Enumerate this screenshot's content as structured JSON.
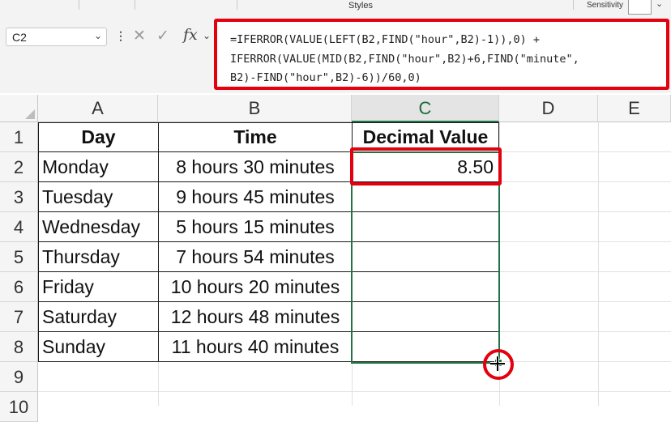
{
  "ribbon": {
    "styles_label": "Styles",
    "sensitivity_label": "Sensitivity"
  },
  "formula_bar": {
    "name_box": "C2",
    "fx_label": "fx",
    "formula_lines": [
      "=IFERROR(VALUE(LEFT(B2,FIND(\"hour\",B2)-1)),0) +",
      "IFERROR(VALUE(MID(B2,FIND(\"hour\",B2)+6,FIND(\"minute\",",
      "B2)-FIND(\"hour\",B2)-6))/60,0)"
    ],
    "icons": [
      "chevron-down-icon",
      "kebab-icon",
      "cancel-icon",
      "enter-icon",
      "fx-icon"
    ]
  },
  "sheet": {
    "columns": [
      "A",
      "B",
      "C",
      "D",
      "E"
    ],
    "rows": [
      "1",
      "2",
      "3",
      "4",
      "5",
      "6",
      "7",
      "8",
      "9",
      "10"
    ],
    "headers": {
      "day": "Day",
      "time": "Time",
      "decimal": "Decimal Value"
    },
    "data": [
      {
        "day": "Monday",
        "time": "8 hours 30 minutes",
        "decimal": "8.50"
      },
      {
        "day": "Tuesday",
        "time": "9 hours 45 minutes",
        "decimal": ""
      },
      {
        "day": "Wednesday",
        "time": "5 hours 15 minutes",
        "decimal": ""
      },
      {
        "day": "Thursday",
        "time": "7 hours 54 minutes",
        "decimal": ""
      },
      {
        "day": "Friday",
        "time": "10 hours 20 minutes",
        "decimal": ""
      },
      {
        "day": "Saturday",
        "time": "12 hours 48 minutes",
        "decimal": ""
      },
      {
        "day": "Sunday",
        "time": "11 hours 40 minutes",
        "decimal": ""
      }
    ],
    "selected_column": "C",
    "selected_range": "C2:C8"
  },
  "colors": {
    "highlight_red": "#e3000f",
    "excel_green": "#217346",
    "header_bg": "#f5f5f5"
  }
}
